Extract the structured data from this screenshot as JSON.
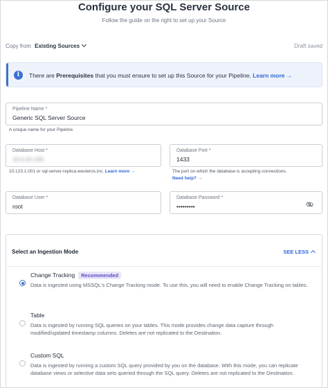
{
  "header": {
    "title": "Configure your SQL Server Source",
    "subtitle": "Follow the guide on the right to set up your Source"
  },
  "copy_from": {
    "label": "Copy from",
    "value": "Existing Sources",
    "status": "Draft saved"
  },
  "info_banner": {
    "text_before": "There are",
    "bold": "Prerequisites",
    "text_after": "that you must ensure to set up this Source for your Pipeline.",
    "link": "Learn more"
  },
  "fields": {
    "pipeline_name": {
      "label": "Pipeline Name *",
      "value": "Generic SQL Server Source",
      "hint": "A unique name for your Pipeline"
    },
    "database_host": {
      "label": "Database Host *",
      "value": "10.0.20.100",
      "hint": "10.123.1.001 or sql-server-replica.westeros.inc.",
      "hint_link": "Learn more"
    },
    "database_port": {
      "label": "Database Port *",
      "value": "1433",
      "hint": "The port on which the database is accepting connections.",
      "hint_link": "Need help?"
    },
    "database_user": {
      "label": "Database User *",
      "value": "root"
    },
    "database_password": {
      "label": "Database Password *",
      "value": "•••••••••"
    }
  },
  "ingestion": {
    "title": "Select an Ingestion Mode",
    "toggle": "SEE LESS",
    "options": [
      {
        "title": "Change Tracking",
        "badge": "Recommended",
        "desc": "Data is ingested using MSSQL's Change Tracking mode. To use this, you will need to enable Change Tracking on tables.",
        "selected": true
      },
      {
        "title": "Table",
        "desc": "Data is ingested by running SQL queries on your tables. This mode provides change data capture through modified/updated timestamp columns. Deletes are not replicated to the Destination.",
        "selected": false
      },
      {
        "title": "Custom SQL",
        "desc": "Data is ingested by running a custom SQL query provided by you on the database. With this mode, you can replicate database views or selective data sets queried through the SQL query. Deletes are not replicated to the Destination.",
        "selected": false
      }
    ]
  }
}
